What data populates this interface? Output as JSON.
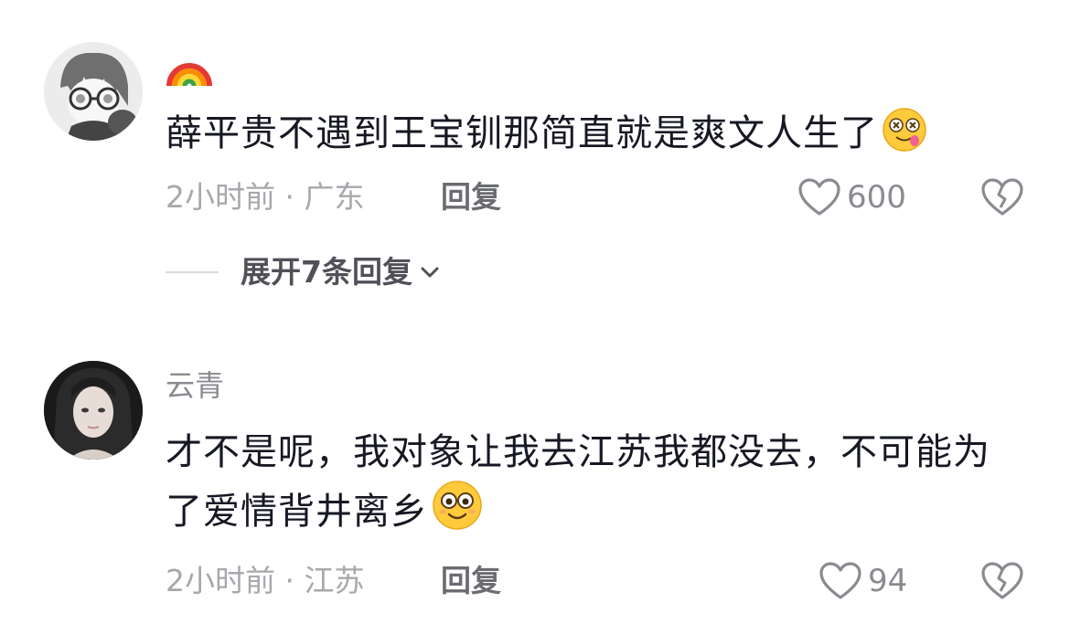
{
  "comments": [
    {
      "username": "",
      "username_icon": "rainbow-emoji",
      "text": "薛平贵不遇到王宝钏那简直就是爽文人生了",
      "trailing_emoji": "drooling-dizzy-emoji",
      "time": "2小时前",
      "location_sep": " · ",
      "location": "广东",
      "reply_label": "回复",
      "likes": "600",
      "expand_label": "展开7条回复"
    },
    {
      "username": "云青",
      "text": "才不是呢，我对象让我去江苏我都没去，不可能为了爱情背井离乡",
      "trailing_emoji": "smiling-emoji",
      "time": "2小时前",
      "location_sep": " · ",
      "location": "江苏",
      "reply_label": "回复",
      "likes": "94"
    }
  ],
  "colors": {
    "text_primary": "#161823",
    "text_secondary": "#a7a8ac",
    "reply": "#6b6c72",
    "icon": "#8a8b91"
  }
}
